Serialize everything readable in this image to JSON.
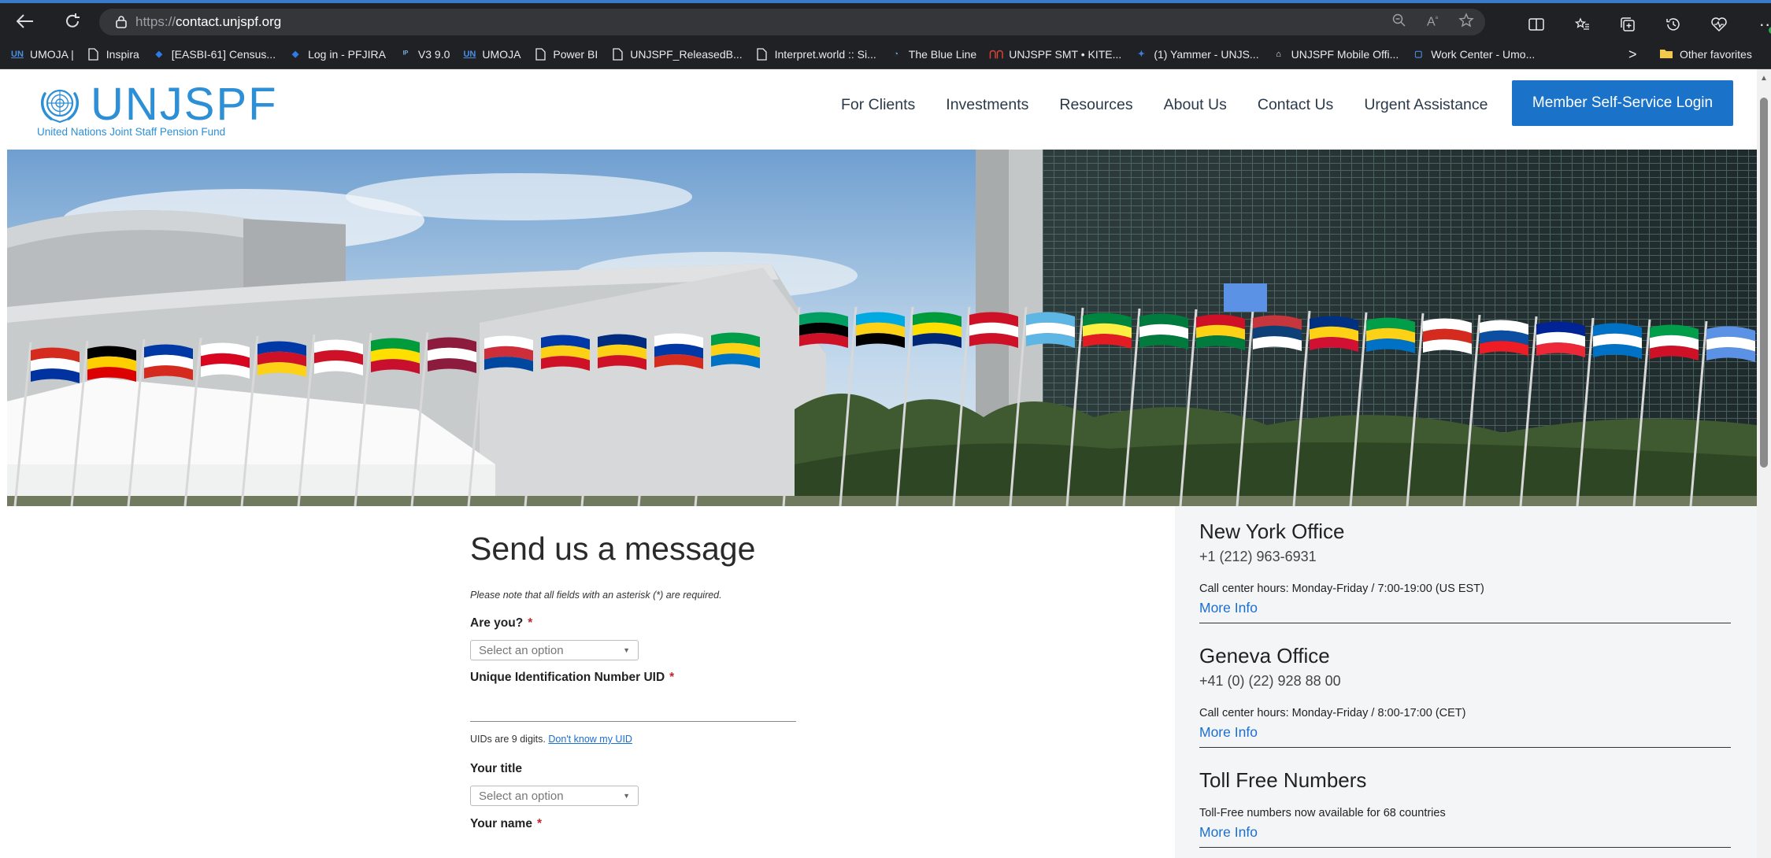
{
  "browser": {
    "url_prefix": "https://",
    "url_domain": "contact.unjspf.org",
    "bookmarks": [
      {
        "label": "UMOJA |",
        "icon": "un-icon"
      },
      {
        "label": "Inspira",
        "icon": "page-icon"
      },
      {
        "label": "[EASBI-61] Census...",
        "icon": "jira-icon"
      },
      {
        "label": "Log in - PFJIRA",
        "icon": "jira-icon"
      },
      {
        "label": "V3 9.0",
        "icon": "ipas-icon"
      },
      {
        "label": "UMOJA",
        "icon": "un-icon"
      },
      {
        "label": "Power BI",
        "icon": "page-icon"
      },
      {
        "label": "UNJSPF_ReleasedB...",
        "icon": "page-icon"
      },
      {
        "label": "Interpret.world :: Si...",
        "icon": "page-icon"
      },
      {
        "label": "The Blue Line",
        "icon": "blueline-icon"
      },
      {
        "label": "UNJSPF SMT • KITE...",
        "icon": "kite-icon"
      },
      {
        "label": "(1) Yammer - UNJS...",
        "icon": "yammer-icon"
      },
      {
        "label": "UNJSPF Mobile Offi...",
        "icon": "mobile-icon"
      },
      {
        "label": "Work Center - Umo...",
        "icon": "workcenter-icon"
      }
    ],
    "bookmarks_more": ">",
    "other_favorites": "Other favorites"
  },
  "site": {
    "logo_word": "UNJSPF",
    "logo_sub": "United Nations Joint Staff Pension Fund",
    "menu": [
      "For Clients",
      "Investments",
      "Resources",
      "About Us",
      "Contact Us",
      "Urgent Assistance"
    ],
    "login_button": "Member Self-Service Login"
  },
  "form": {
    "title": "Send us a message",
    "note": "Please note that all fields with an asterisk (*) are required.",
    "are_you_label": "Are you?",
    "are_you_placeholder": "Select an option",
    "uid_label": "Unique Identification Number UID",
    "uid_value": "",
    "uid_hint": "UIDs are 9 digits.",
    "uid_link": "Don't know my UID",
    "title_label": "Your title",
    "title_placeholder": "Select an option",
    "name_label": "Your name",
    "required_mark": "*"
  },
  "offices": [
    {
      "name": "New York Office",
      "phone": "+1 (212) 963-6931",
      "hours": "Call center hours: Monday-Friday / 7:00-19:00 (US EST)",
      "more": "More Info"
    },
    {
      "name": "Geneva Office",
      "phone": "+41 (0) (22) 928 88 00",
      "hours": "Call center hours: Monday-Friday / 8:00-17:00 (CET)",
      "more": "More Info"
    },
    {
      "name": "Toll Free Numbers",
      "phone": "",
      "hours": "Toll-Free numbers now available for 68 countries",
      "more": "More Info"
    }
  ],
  "colors": {
    "brand_blue": "#2d8fd5",
    "button_blue": "#1a73c9",
    "link_blue": "#1a6fd1",
    "required_red": "#c0272d"
  }
}
